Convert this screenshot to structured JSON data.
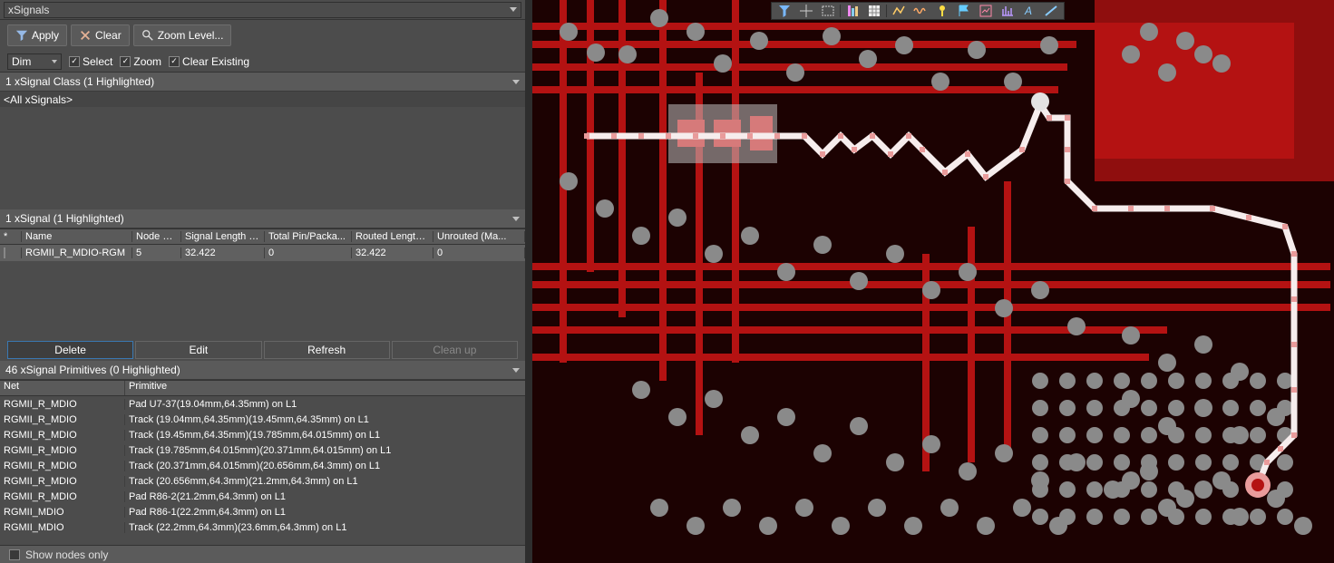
{
  "panel": {
    "title": "xSignals",
    "apply": "Apply",
    "clear": "Clear",
    "zoom_level": "Zoom Level...",
    "dim_label": "Dim",
    "select": "Select",
    "zoom": "Zoom",
    "clear_existing": "Clear Existing"
  },
  "class_section": {
    "title": "1 xSignal Class (1 Highlighted)",
    "rows": [
      "<All xSignals>"
    ]
  },
  "xsignal_section": {
    "title": "1 xSignal (1 Highlighted)",
    "columns": {
      "star": "*",
      "name": "Name",
      "node": "Node C...",
      "sig": "Signal Length (...",
      "pin": "Total Pin/Packa...",
      "rt": "Routed Length(...",
      "un": "Unrouted (Ma..."
    },
    "row": {
      "name": "RGMII_R_MDIO-RGM",
      "node": "5",
      "sig": "32.422",
      "pin": "0",
      "rt": "32.422",
      "un": "0"
    }
  },
  "actions": {
    "delete": "Delete",
    "edit": "Edit",
    "refresh": "Refresh",
    "cleanup": "Clean up"
  },
  "prim_section": {
    "title": "46 xSignal Primitives (0 Highlighted)",
    "columns": {
      "net": "Net",
      "prim": "Primitive"
    },
    "rows": [
      {
        "net": "RGMII_R_MDIO",
        "prim": "Pad U7-37(19.04mm,64.35mm)  on L1"
      },
      {
        "net": "RGMII_R_MDIO",
        "prim": "Track (19.04mm,64.35mm)(19.45mm,64.35mm) on L1"
      },
      {
        "net": "RGMII_R_MDIO",
        "prim": "Track (19.45mm,64.35mm)(19.785mm,64.015mm) on L1"
      },
      {
        "net": "RGMII_R_MDIO",
        "prim": "Track (19.785mm,64.015mm)(20.371mm,64.015mm) on L1"
      },
      {
        "net": "RGMII_R_MDIO",
        "prim": "Track (20.371mm,64.015mm)(20.656mm,64.3mm) on L1"
      },
      {
        "net": "RGMII_R_MDIO",
        "prim": "Track (20.656mm,64.3mm)(21.2mm,64.3mm) on L1"
      },
      {
        "net": "RGMII_R_MDIO",
        "prim": "Pad R86-2(21.2mm,64.3mm)  on L1"
      },
      {
        "net": "RGMII_MDIO",
        "prim": "Pad R86-1(22.2mm,64.3mm)  on L1"
      },
      {
        "net": "RGMII_MDIO",
        "prim": "Track (22.2mm,64.3mm)(23.6mm,64.3mm) on L1"
      }
    ]
  },
  "bottom": {
    "show_nodes": "Show nodes only"
  },
  "toolbar_icons": [
    "filter-icon",
    "crosshair-icon",
    "select-rect-icon",
    "align-icon",
    "grid-icon",
    "route-icon",
    "wave-icon",
    "pin-icon",
    "flag-icon",
    "chart-icon",
    "plot-icon",
    "text-icon",
    "line-icon"
  ],
  "colors": {
    "copper": "#b41212",
    "copper_dim": "#6e0d0d",
    "via": "#8a8a8a",
    "hilite": "#f2d7d7",
    "bg": "#0c0000",
    "pour": "#2e0404"
  }
}
